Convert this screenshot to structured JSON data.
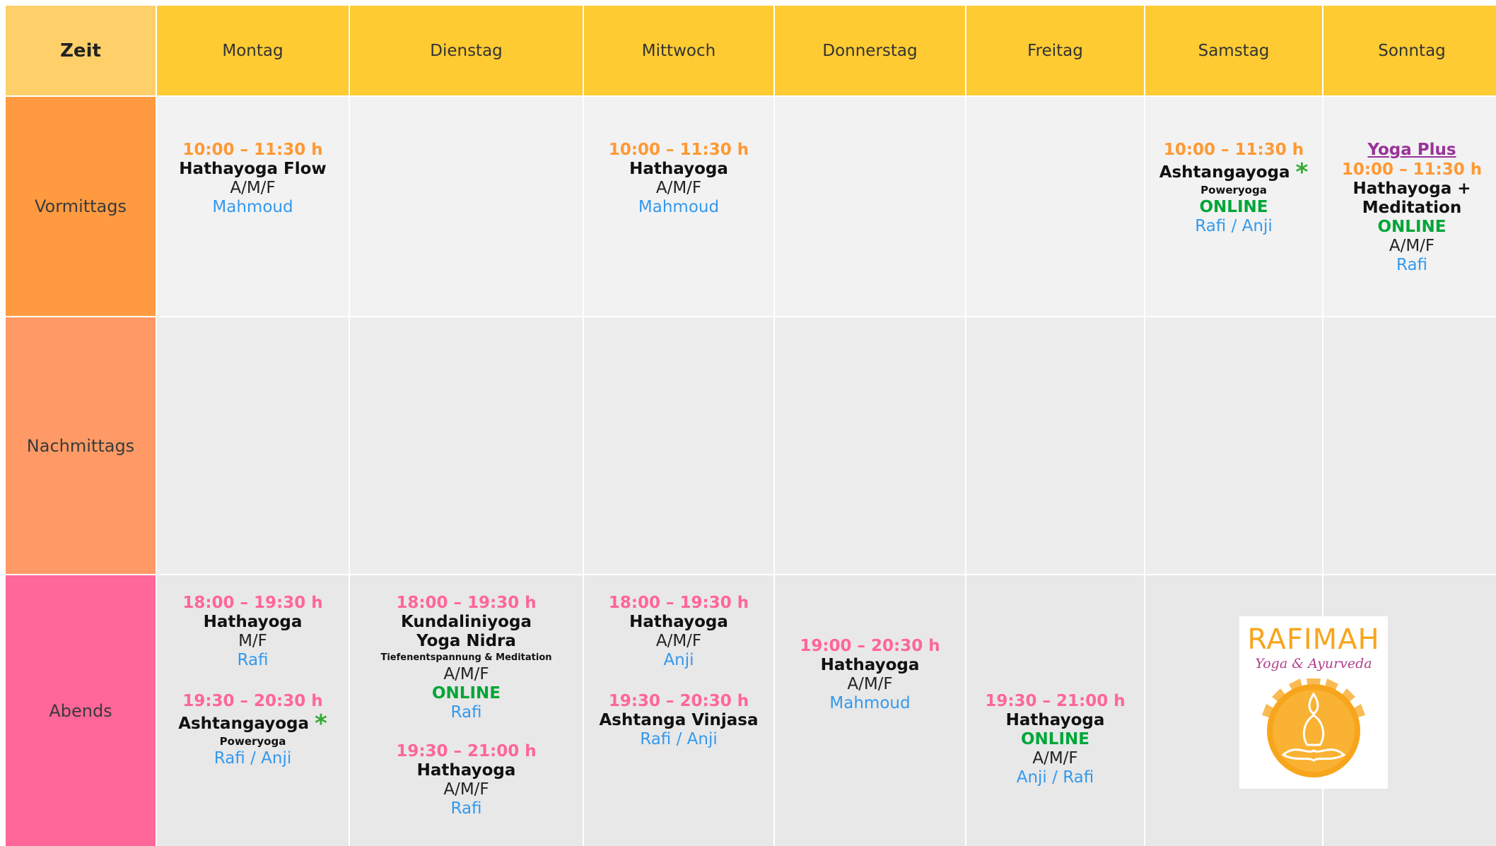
{
  "header": {
    "zeit": "Zeit",
    "days": [
      "Montag",
      "Dienstag",
      "Mittwoch",
      "Donnerstag",
      "Freitag",
      "Samstag",
      "Sonntag"
    ]
  },
  "rows": [
    "Vormittags",
    "Nachmittags",
    "Abends"
  ],
  "colors": {
    "header": "#ffcb33",
    "vormittags": "#ff9a40",
    "nachmittags": "#ff9a66",
    "abends": "#ff6699",
    "online": "#00a638",
    "teacher": "#3399ee",
    "star": "#33aa33"
  },
  "vormittags": {
    "montag": {
      "time": "10:00 – 11:30 h",
      "course": "Hathayoga Flow",
      "level": "A/M/F",
      "teacher": "Mahmoud"
    },
    "mittwoch": {
      "time": "10:00 – 11:30 h",
      "course": "Hathayoga",
      "level": "A/M/F",
      "teacher": "Mahmoud"
    },
    "samstag": {
      "time": "10:00 – 11:30 h",
      "course": "Ashtangayoga",
      "star": "*",
      "sub": "Poweryoga",
      "online": "ONLINE",
      "teacher": "Rafi / Anji"
    },
    "sonntag": {
      "link": "Yoga Plus",
      "time": "10:00 – 11:30 h",
      "course1": "Hathayoga +",
      "course2": "Meditation",
      "online": "ONLINE",
      "level": "A/M/F",
      "teacher": "Rafi"
    }
  },
  "abends": {
    "montag": [
      {
        "time": "18:00 – 19:30 h",
        "course": "Hathayoga",
        "level": "M/F",
        "teacher": "Rafi"
      },
      {
        "time": "19:30 – 20:30 h",
        "course": "Ashtangayoga",
        "star": "*",
        "sub": "Poweryoga",
        "teacher": "Rafi / Anji"
      }
    ],
    "dienstag": [
      {
        "time": "18:00 – 19:30 h",
        "course1": "Kundaliniyoga",
        "course2": "Yoga Nidra",
        "sub": "Tiefenentspannung & Meditation",
        "level": "A/M/F",
        "online": "ONLINE",
        "teacher": "Rafi"
      },
      {
        "time": "19:30 – 21:00 h",
        "course": "Hathayoga",
        "level": "A/M/F",
        "teacher": "Rafi"
      }
    ],
    "mittwoch": [
      {
        "time": "18:00 – 19:30 h",
        "course": "Hathayoga",
        "level": "A/M/F",
        "teacher": "Anji"
      },
      {
        "time": "19:30 – 20:30 h",
        "course": "Ashtanga Vinjasa",
        "teacher": "Rafi / Anji"
      }
    ],
    "donnerstag": [
      {
        "time": "19:00 – 20:30 h",
        "course": "Hathayoga",
        "level": "A/M/F",
        "teacher": "Mahmoud"
      }
    ],
    "freitag": [
      {
        "time": "19:30 – 21:00 h",
        "course": "Hathayoga",
        "online": "ONLINE",
        "level": "A/M/F",
        "teacher": "Anji / Rafi"
      }
    ]
  },
  "logo": {
    "name": "RAFIMAH",
    "tagline": "Yoga & Ayurveda"
  }
}
